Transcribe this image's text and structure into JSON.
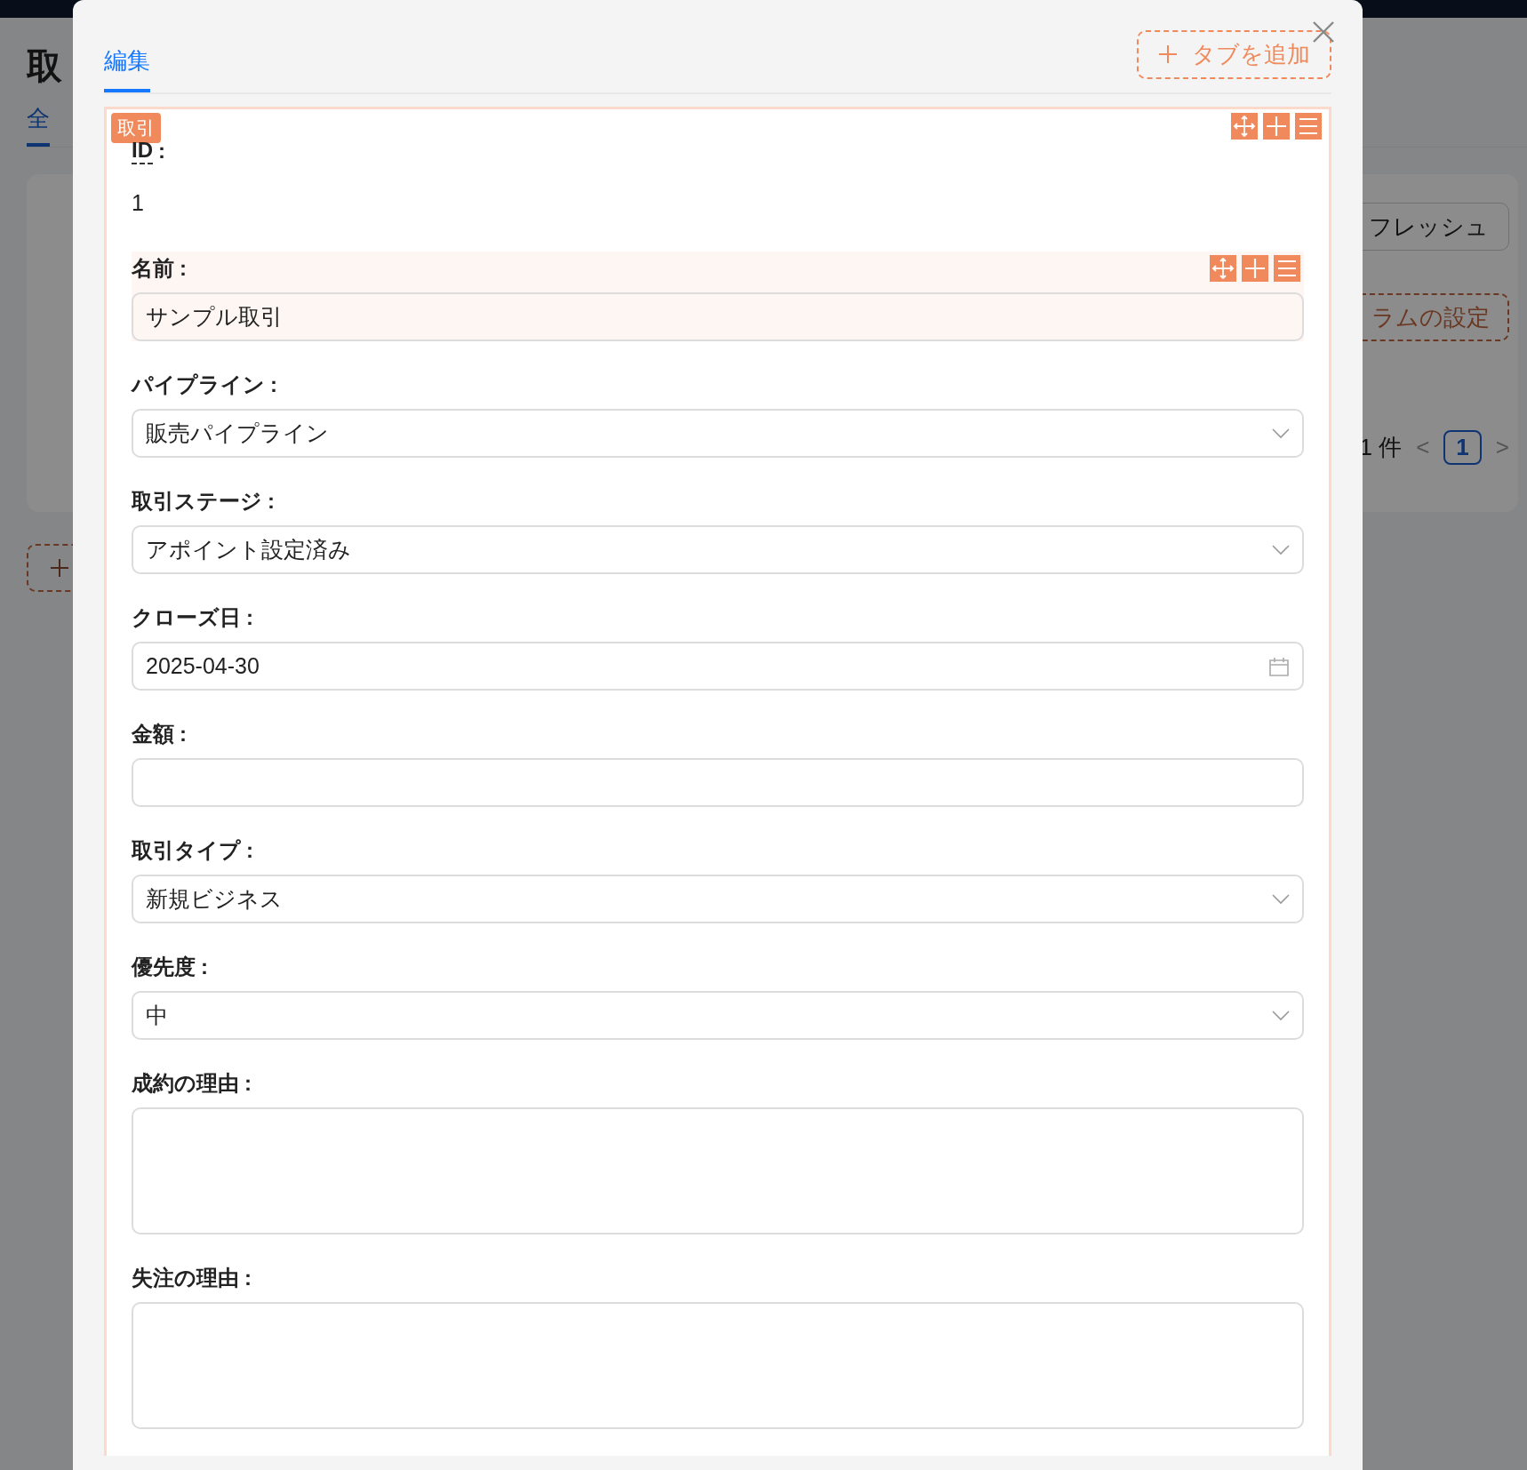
{
  "background_page": {
    "title": "取",
    "tabs": [
      {
        "label": "全",
        "selected": true
      }
    ],
    "refresh_button": "フレッシュ",
    "column_settings_button": "ラムの設定",
    "pagination": {
      "total": "1 件",
      "prev": "<",
      "pages": [
        {
          "label": "1",
          "selected": true
        }
      ],
      "next": ">"
    }
  },
  "dialog": {
    "tabs": [
      {
        "label": "編集",
        "selected": true
      }
    ],
    "add_tab_button": "タブを追加",
    "section": {
      "badge": "取引",
      "fields": [
        {
          "kind": "static",
          "label": "ID",
          "suffix": ":",
          "value": "1",
          "has_tooltip": true,
          "highlighted": false
        },
        {
          "kind": "text",
          "label": "名前",
          "suffix": ":",
          "value": "サンプル取引",
          "has_tooltip": false,
          "highlighted": true
        },
        {
          "kind": "select",
          "label": "パイプライン",
          "suffix": ":",
          "value": "販売パイプライン",
          "has_tooltip": false,
          "highlighted": false
        },
        {
          "kind": "select",
          "label": "取引ステージ",
          "suffix": ":",
          "value": "アポイント設定済み",
          "has_tooltip": false,
          "highlighted": false
        },
        {
          "kind": "date",
          "label": "クローズ日",
          "suffix": ":",
          "value": "2025-04-30",
          "has_tooltip": false,
          "highlighted": false
        },
        {
          "kind": "text",
          "label": "金額",
          "suffix": ":",
          "has_tooltip": false,
          "highlighted": false
        },
        {
          "kind": "select",
          "label": "取引タイプ",
          "suffix": ":",
          "value": "新規ビジネス",
          "has_tooltip": false,
          "highlighted": false
        },
        {
          "kind": "select",
          "label": "優先度",
          "suffix": ":",
          "value": "中",
          "has_tooltip": false,
          "highlighted": false
        },
        {
          "kind": "textarea",
          "label": "成約の理由",
          "suffix": ":",
          "has_tooltip": false,
          "highlighted": false
        },
        {
          "kind": "textarea",
          "label": "失注の理由",
          "suffix": ":",
          "has_tooltip": false,
          "highlighted": false
        }
      ]
    }
  }
}
